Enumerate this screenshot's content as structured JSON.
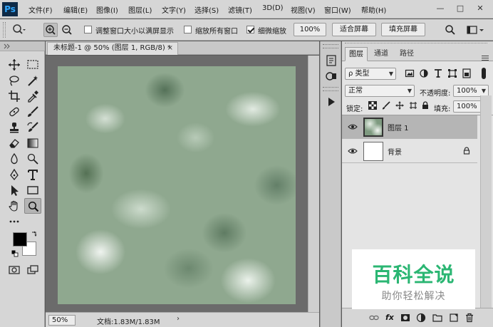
{
  "app": {
    "logo": "Ps",
    "menu": [
      "文件(F)",
      "编辑(E)",
      "图像(I)",
      "图层(L)",
      "文字(Y)",
      "选择(S)",
      "滤镜(T)",
      "3D(D)",
      "视图(V)",
      "窗口(W)",
      "帮助(H)"
    ],
    "window_controls": [
      "—",
      "□",
      "✕"
    ]
  },
  "options_bar": {
    "resize_windows_label": "调整窗口大小以满屏显示",
    "resize_windows_checked": false,
    "zoom_all_windows_label": "缩放所有窗口",
    "zoom_all_windows_checked": false,
    "scrubby_zoom_label": "细微缩放",
    "scrubby_zoom_checked": true,
    "btn_100": "100%",
    "btn_fit_screen": "适合屏幕",
    "btn_fill_screen": "填充屏幕"
  },
  "document": {
    "tab_title": "未标题-1 @ 50% (图层 1, RGB/8) *",
    "tab_close": "×",
    "zoom": "50%",
    "info": "文档:1.83M/1.83M",
    "info_arrow": "›"
  },
  "colors": {
    "foreground": "#000000",
    "background": "#ffffff"
  },
  "layers_panel": {
    "tabs": [
      "图层",
      "通道",
      "路径"
    ],
    "active_tab": "图层",
    "filter_kind": "ρ 类型",
    "blend_mode": "正常",
    "opacity_label": "不透明度:",
    "opacity_value": "100%",
    "lock_label": "锁定:",
    "fill_label": "填充:",
    "fill_value": "100%",
    "layers": [
      {
        "name": "图层 1",
        "visible": true,
        "selected": true,
        "locked": false
      },
      {
        "name": "背景",
        "visible": true,
        "selected": false,
        "locked": true
      }
    ],
    "footer_fx": "fx"
  },
  "watermark": {
    "title": "百科全说",
    "subtitle": "助你轻松解决"
  }
}
